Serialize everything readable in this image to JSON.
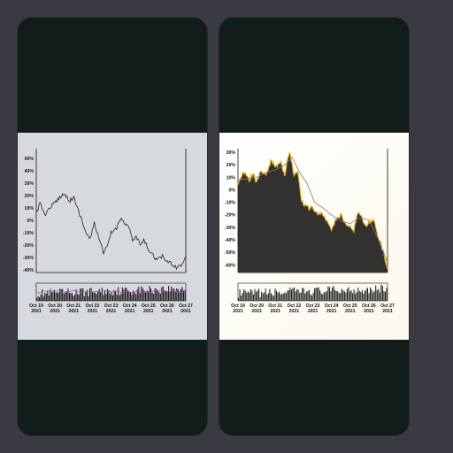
{
  "chart_data": [
    {
      "type": "line",
      "background": "#d6dadf",
      "line_color": "#222222",
      "ylim": [
        -42,
        58
      ],
      "yticks": [
        "50%",
        "40%",
        "30%",
        "20%",
        "10%",
        "0%",
        "-10%",
        "-20%",
        "-30%",
        "-40%"
      ],
      "xticks": [
        [
          "Oct 19",
          "2021"
        ],
        [
          "Oct 20",
          "2021"
        ],
        [
          "Oct 21",
          "2021"
        ],
        [
          "Oct 22",
          "2021"
        ],
        [
          "Oct 23",
          "2021"
        ],
        [
          "Oct 24",
          "2021"
        ],
        [
          "Oct 25",
          "2021"
        ],
        [
          "Oct 26",
          "2021"
        ],
        [
          "Oct 27",
          "2021"
        ]
      ],
      "x_days": [
        0,
        1,
        2,
        3,
        4,
        5,
        6,
        7,
        8
      ],
      "series": [
        {
          "values": [
            [
              0,
              7
            ],
            [
              0.2,
              13
            ],
            [
              0.5,
              5
            ],
            [
              0.8,
              12
            ],
            [
              1.0,
              14
            ],
            [
              1.2,
              18
            ],
            [
              1.4,
              21
            ],
            [
              1.6,
              20
            ],
            [
              1.8,
              16
            ],
            [
              2.0,
              19
            ],
            [
              2.2,
              10
            ],
            [
              2.45,
              0
            ],
            [
              2.65,
              -10
            ],
            [
              2.9,
              -15
            ],
            [
              3.1,
              -2
            ],
            [
              3.35,
              -14
            ],
            [
              3.6,
              -27
            ],
            [
              3.85,
              -19
            ],
            [
              4.0,
              -10
            ],
            [
              4.3,
              -6
            ],
            [
              4.55,
              3
            ],
            [
              4.75,
              -3
            ],
            [
              5.0,
              -6
            ],
            [
              5.15,
              -17
            ],
            [
              5.35,
              -13
            ],
            [
              5.55,
              -20
            ],
            [
              5.75,
              -16
            ],
            [
              6.0,
              -23
            ],
            [
              6.25,
              -28
            ],
            [
              6.45,
              -32
            ],
            [
              6.75,
              -29
            ],
            [
              7.0,
              -33
            ],
            [
              7.25,
              -35
            ],
            [
              7.5,
              -38
            ],
            [
              7.75,
              -36
            ],
            [
              8.0,
              -29
            ]
          ]
        }
      ],
      "volume": {
        "color": "#1a1a1a",
        "ma_color": "#b04fb4"
      }
    },
    {
      "type": "area",
      "background": "#fdf8ec",
      "fill_color": "#333030",
      "edge_color": "#e6b422",
      "ma_color": "#8a7f66",
      "ylim": [
        -66,
        33
      ],
      "yticks": [
        "30%",
        "20%",
        "10%",
        "0%",
        "-10%",
        "-20%",
        "-30%",
        "-40%",
        "-50%",
        "-60%"
      ],
      "xticks": [
        [
          "Oct 19",
          "2021"
        ],
        [
          "Oct 20",
          "2021"
        ],
        [
          "Oct 21",
          "2021"
        ],
        [
          "Oct 22",
          "2021"
        ],
        [
          "Oct 23",
          "2021"
        ],
        [
          "Oct 24",
          "2021"
        ],
        [
          "Oct 25",
          "2021"
        ],
        [
          "Oct 26",
          "2021"
        ],
        [
          "Oct 27",
          "2021"
        ]
      ],
      "x_days": [
        0,
        1,
        2,
        3,
        4,
        5,
        6,
        7,
        8
      ],
      "series": [
        {
          "values": [
            [
              0,
              4
            ],
            [
              0.3,
              14
            ],
            [
              0.6,
              8
            ],
            [
              0.8,
              13
            ],
            [
              1.0,
              6
            ],
            [
              1.2,
              15
            ],
            [
              1.5,
              12
            ],
            [
              1.8,
              24
            ],
            [
              2.0,
              18
            ],
            [
              2.3,
              21
            ],
            [
              2.5,
              12
            ],
            [
              2.75,
              31
            ],
            [
              3.0,
              12
            ],
            [
              3.2,
              14
            ],
            [
              3.4,
              -9
            ],
            [
              3.6,
              -12
            ],
            [
              3.85,
              -15
            ],
            [
              4.0,
              -13
            ],
            [
              4.25,
              -20
            ],
            [
              4.5,
              -19
            ],
            [
              4.75,
              -24
            ],
            [
              5.0,
              -31
            ],
            [
              5.25,
              -23
            ],
            [
              5.5,
              -20
            ],
            [
              5.75,
              -27
            ],
            [
              6.0,
              -28
            ],
            [
              6.2,
              -32
            ],
            [
              6.4,
              -19
            ],
            [
              6.6,
              -21
            ],
            [
              6.85,
              -30
            ],
            [
              7.0,
              -26
            ],
            [
              7.3,
              -24
            ],
            [
              7.5,
              -38
            ],
            [
              7.75,
              -48
            ],
            [
              8.0,
              -63
            ]
          ]
        }
      ],
      "moving_average": [
        [
          0,
          8
        ],
        [
          0.5,
          9
        ],
        [
          1.0,
          10
        ],
        [
          1.5,
          14
        ],
        [
          2.0,
          16
        ],
        [
          2.5,
          20
        ],
        [
          2.9,
          26
        ],
        [
          3.3,
          14
        ],
        [
          3.7,
          5
        ],
        [
          4.1,
          -10
        ],
        [
          4.5,
          -14
        ],
        [
          5.0,
          -20
        ],
        [
          5.5,
          -25
        ],
        [
          6.0,
          -27
        ],
        [
          6.5,
          -22
        ],
        [
          7.0,
          -24
        ],
        [
          7.5,
          -39
        ],
        [
          8.0,
          -58
        ]
      ]
    }
  ]
}
